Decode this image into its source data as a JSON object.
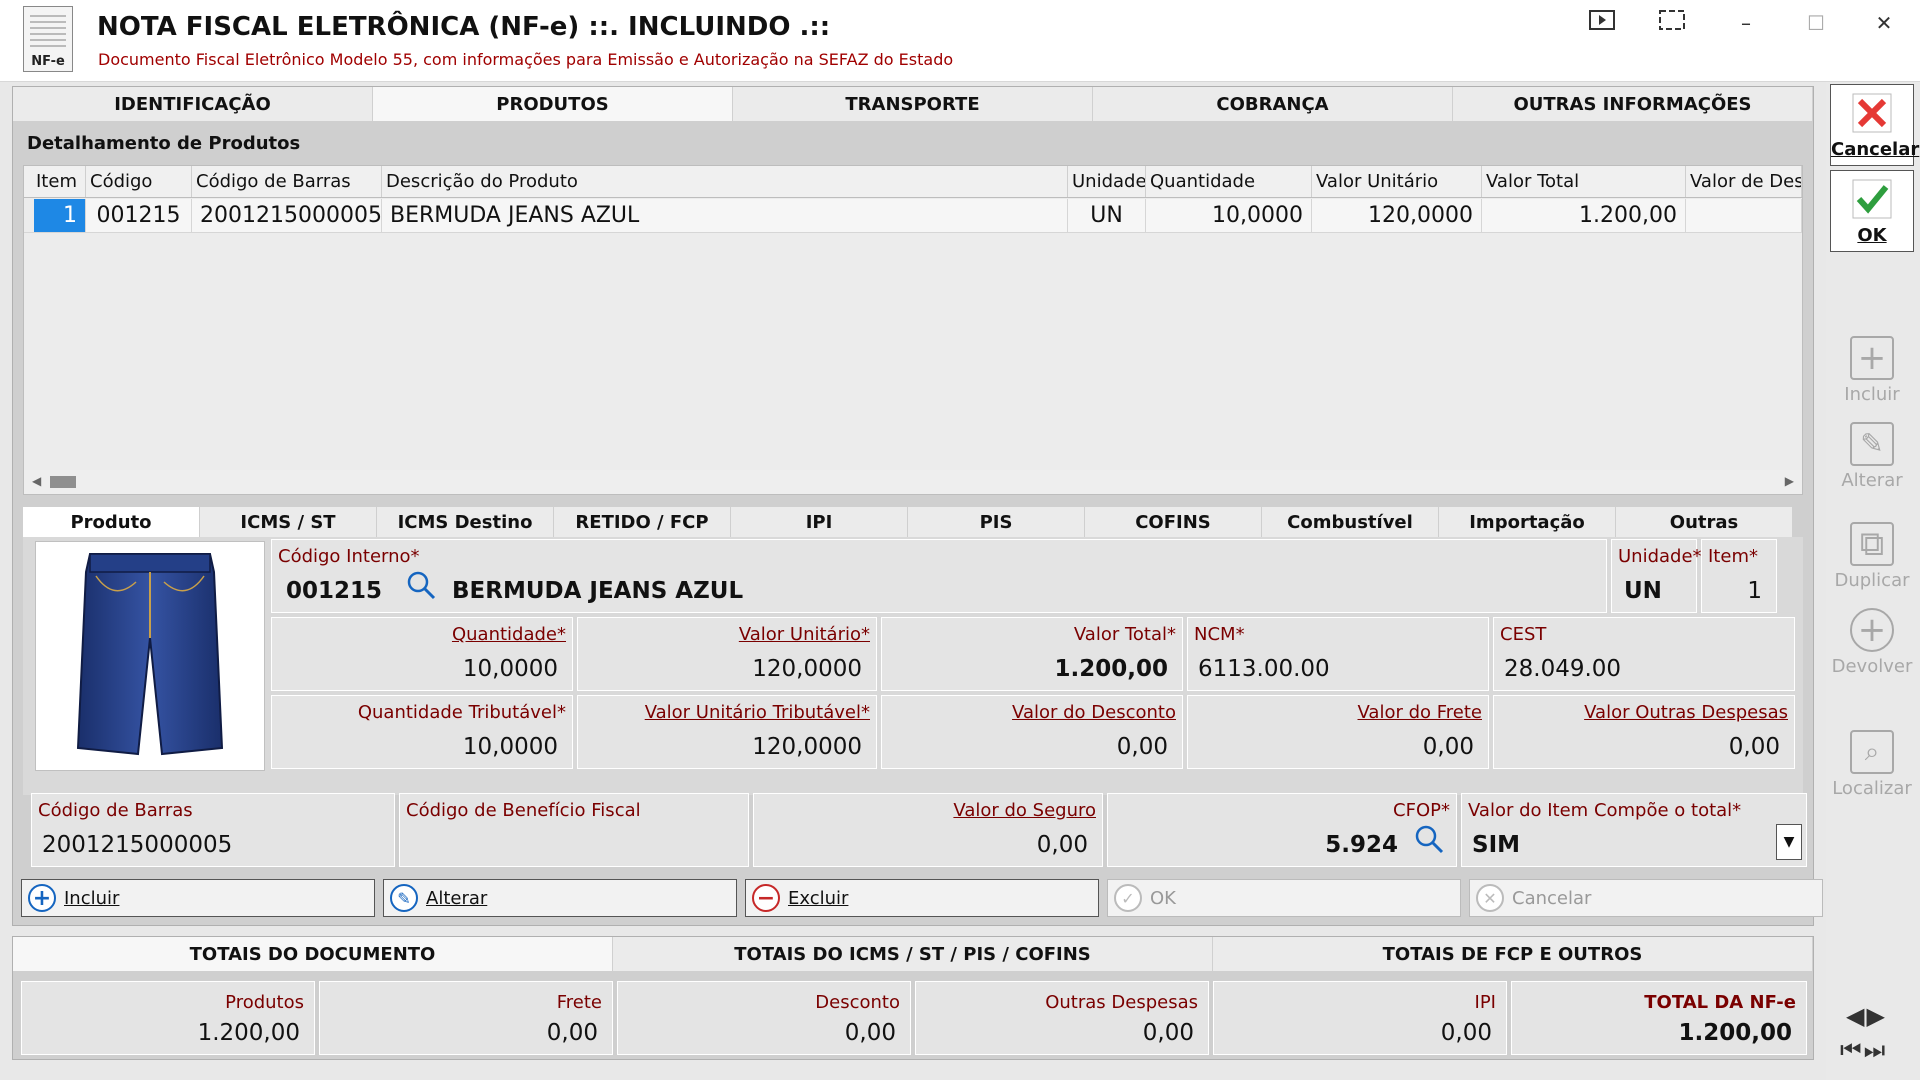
{
  "window": {
    "icon_label": "NF-e",
    "title": "NOTA FISCAL ELETRÔNICA (NF-e) ::. INCLUINDO .::",
    "subtitle": "Documento Fiscal Eletrônico Modelo 55, com informações para Emissão e Autorização na SEFAZ do Estado"
  },
  "main_tabs": [
    "IDENTIFICAÇÃO",
    "PRODUTOS",
    "TRANSPORTE",
    "COBRANÇA",
    "OUTRAS INFORMAÇÕES"
  ],
  "section_title": "Detalhamento de Produtos",
  "grid": {
    "columns": [
      "Item",
      "Código",
      "Código de Barras",
      "Descrição do Produto",
      "Unidade",
      "Quantidade",
      "Valor Unitário",
      "Valor Total",
      "Valor de Des"
    ],
    "rows": [
      [
        "1",
        "001215",
        "2001215000005",
        "BERMUDA JEANS AZUL",
        "UN",
        "10,0000",
        "120,0000",
        "1.200,00",
        ""
      ]
    ]
  },
  "sub_tabs": [
    "Produto",
    "ICMS / ST",
    "ICMS Destino",
    "RETIDO / FCP",
    "IPI",
    "PIS",
    "COFINS",
    "Combustível",
    "Importação",
    "Outras"
  ],
  "product": {
    "codigo_interno_label": "Código Interno*",
    "codigo_interno": "001215",
    "descricao": "BERMUDA JEANS AZUL",
    "unidade_label": "Unidade*",
    "unidade": "UN",
    "item_label": "Item*",
    "item": "1",
    "quantidade_label": "Quantidade*",
    "quantidade": "10,0000",
    "valor_unitario_label": "Valor Unitário*",
    "valor_unitario": "120,0000",
    "valor_total_label": "Valor Total*",
    "valor_total": "1.200,00",
    "ncm_label": "NCM*",
    "ncm": "6113.00.00",
    "cest_label": "CEST",
    "cest": "28.049.00",
    "qtd_trib_label": "Quantidade Tributável*",
    "qtd_trib": "10,0000",
    "vu_trib_label": "Valor Unitário Tributável*",
    "vu_trib": "120,0000",
    "desconto_label": "Valor do Desconto",
    "desconto": "0,00",
    "frete_label": "Valor do Frete",
    "frete": "0,00",
    "outras_label": "Valor Outras Despesas",
    "outras": "0,00",
    "barras_label": "Código de Barras",
    "barras": "2001215000005",
    "beneficio_label": "Código de Benefício Fiscal",
    "beneficio": "",
    "seguro_label": "Valor do Seguro",
    "seguro": "0,00",
    "cfop_label": "CFOP*",
    "cfop": "5.924",
    "compoe_label": "Valor do Item Compõe o total*",
    "compoe": "SIM"
  },
  "actions": {
    "incluir": "Incluir",
    "alterar": "Alterar",
    "excluir": "Excluir",
    "ok": "OK",
    "cancelar": "Cancelar"
  },
  "totals_tabs": [
    "TOTAIS DO DOCUMENTO",
    "TOTAIS DO ICMS / ST / PIS / COFINS",
    "TOTAIS DE FCP E OUTROS"
  ],
  "totals": [
    {
      "label": "Produtos",
      "value": "1.200,00"
    },
    {
      "label": "Frete",
      "value": "0,00"
    },
    {
      "label": "Desconto",
      "value": "0,00"
    },
    {
      "label": "Outras Despesas",
      "value": "0,00"
    },
    {
      "label": "IPI",
      "value": "0,00"
    },
    {
      "label": "TOTAL DA NF-e",
      "value": "1.200,00"
    }
  ],
  "sidebar": {
    "cancelar": "Cancelar",
    "ok": "OK",
    "incluir": "Incluir",
    "alterar": "Alterar",
    "duplicar": "Duplicar",
    "devolver": "Devolver",
    "localizar": "Localizar"
  },
  "colors": {
    "label_red": "#7a0000",
    "selection_blue": "#1e88e5",
    "cancel_red": "#e53935",
    "ok_green": "#2e9e3e"
  }
}
